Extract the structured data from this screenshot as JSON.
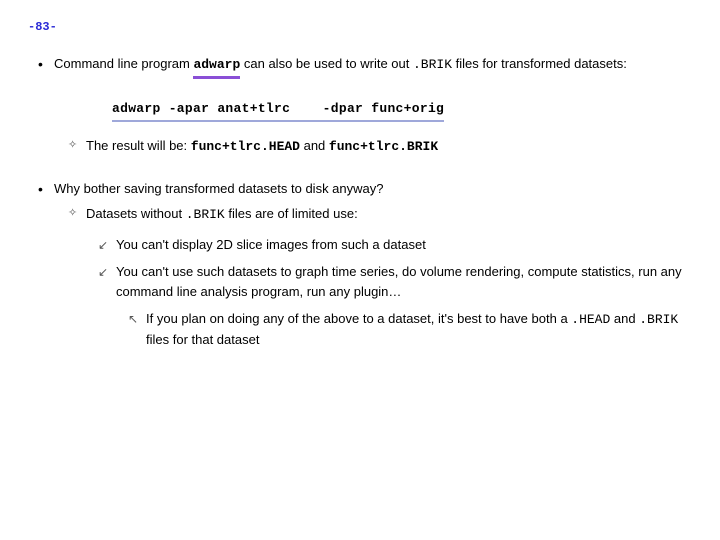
{
  "page_number": "-83-",
  "bullet1": {
    "pre": "Command line program ",
    "prog": "adwarp",
    "mid": " can also be used to write out ",
    "ext": ".BRIK",
    "post": " files for transformed datasets:"
  },
  "cmd": {
    "c1": "adwarp -apar anat+tlrc",
    "c2": "-dpar func+orig"
  },
  "result": {
    "pre": "The result will be: ",
    "f1": "func+tlrc.HEAD",
    "mid": " and ",
    "f2": "func+tlrc.BRIK"
  },
  "bullet2": "Why bother saving transformed datasets to disk anyway?",
  "sub2": {
    "pre": "Datasets without ",
    "ext": ".BRIK",
    "post": " files are of limited use:"
  },
  "cannot1": "You can't display 2D slice images from such a dataset",
  "cannot2": "You can't use such datasets to graph time series, do volume rendering, compute statistics, run any command line analysis program, run any plugin…",
  "advice": {
    "pre": "If you plan on doing any of the above to a dataset, it's best to have both a ",
    "h": ".HEAD",
    "mid": " and ",
    "b": ".BRIK",
    "post": " files for that dataset"
  }
}
